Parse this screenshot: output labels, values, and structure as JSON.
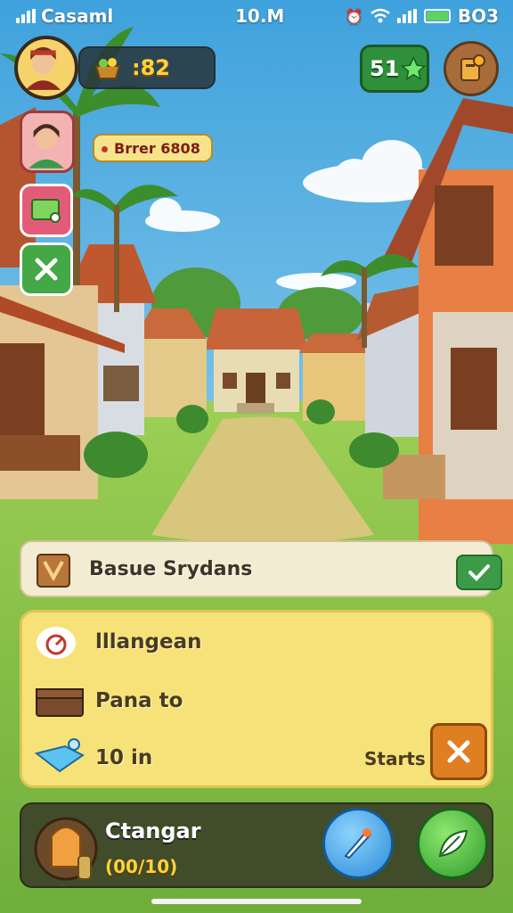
{
  "status_bar": {
    "carrier": "Casaml",
    "time": "10.M",
    "battery_label": "BO3"
  },
  "hud": {
    "coins": ":82",
    "gems": "51",
    "event_tag": "Brrer 6808"
  },
  "quest_banner": {
    "title": "Basue Srydans"
  },
  "tasks": [
    {
      "label": "lllangean",
      "icon": "stopwatch-icon"
    },
    {
      "label": "Pana to",
      "icon": "chest-icon"
    },
    {
      "label": "10 in",
      "icon": "drone-icon",
      "side_label": "Starts"
    }
  ],
  "bottom_bar": {
    "name": "Ctangar",
    "progress": "(00/10)"
  },
  "colors": {
    "sky": "#7fc4e8",
    "coin_text": "#ffd23a",
    "gem_panel": "#2f8f3a",
    "task_panel": "#f7e27a",
    "close_button": "#e07f21"
  }
}
